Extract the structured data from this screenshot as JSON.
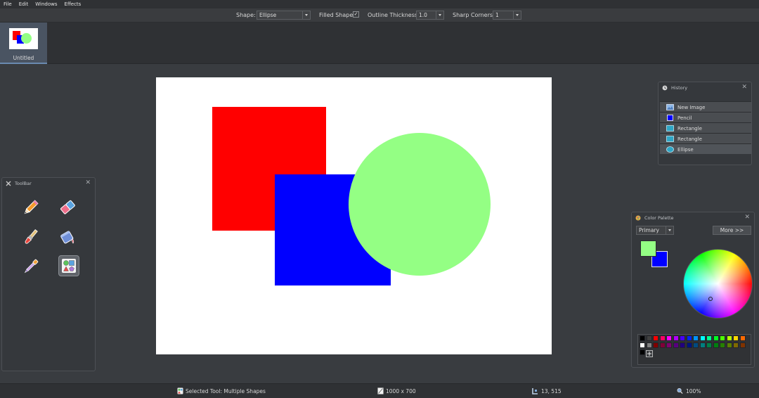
{
  "menu": [
    "File",
    "Edit",
    "Windows",
    "Effects"
  ],
  "toolbar": {
    "shape_label": "Shape:",
    "shape_value": "Ellipse",
    "filled_label": "Filled Shape:",
    "filled_checked": true,
    "filled_check_glyph": "✓",
    "outline_label": "Outline Thickness:",
    "outline_value": "1.0",
    "corners_label": "Sharp Corners:",
    "corners_value": "1"
  },
  "document": {
    "title": "Untitled"
  },
  "canvas_shapes": {
    "rect1_color": "#ff0000",
    "rect2_color": "#0000ff",
    "ellipse_color": "#94ff84"
  },
  "toolbar_panel": {
    "title": "ToolBar",
    "close": "✕",
    "tools": [
      "pencil-tool",
      "eraser-tool",
      "paintbrush-tool",
      "paint-bucket-tool",
      "color-picker-tool",
      "shapes-tool"
    ],
    "selected_tool": "shapes-tool"
  },
  "history": {
    "title": "History",
    "close": "✕",
    "items": [
      {
        "label": "New Image",
        "icon": "image-icon"
      },
      {
        "label": "Pencil",
        "icon": "pencil-history-icon"
      },
      {
        "label": "Rectangle",
        "icon": "rectangle-icon"
      },
      {
        "label": "Rectangle",
        "icon": "rectangle-icon"
      },
      {
        "label": "Ellipse",
        "icon": "ellipse-icon"
      }
    ]
  },
  "palette": {
    "title": "Color Palette",
    "close": "✕",
    "mode": "Primary",
    "more_label": "More >>",
    "primary_color": "#94ff84",
    "secondary_color": "#0000ff",
    "swatches_row1": [
      "#000000",
      "#404040",
      "#ff0000",
      "#ff0066",
      "#ff00ff",
      "#b200ff",
      "#4800ff",
      "#0026ff",
      "#0094ff",
      "#00ffff",
      "#00ff90",
      "#00ff21",
      "#4cff00",
      "#b6ff00",
      "#ffd800",
      "#ff6a00"
    ],
    "swatches_row2": [
      "#ffffff",
      "#808080",
      "#7f0000",
      "#7f0037",
      "#7f006e",
      "#57007f",
      "#21007f",
      "#00137f",
      "#004a7f",
      "#007f7f",
      "#007f46",
      "#007f0e",
      "#267f00",
      "#5b7f00",
      "#7f6a00",
      "#7f3300"
    ],
    "swatches_row3": [
      "#000000"
    ]
  },
  "status": {
    "tool": "Selected Tool: Multiple Shapes",
    "size": "1000 x 700",
    "coords": "13, 515",
    "zoom": "100%"
  }
}
